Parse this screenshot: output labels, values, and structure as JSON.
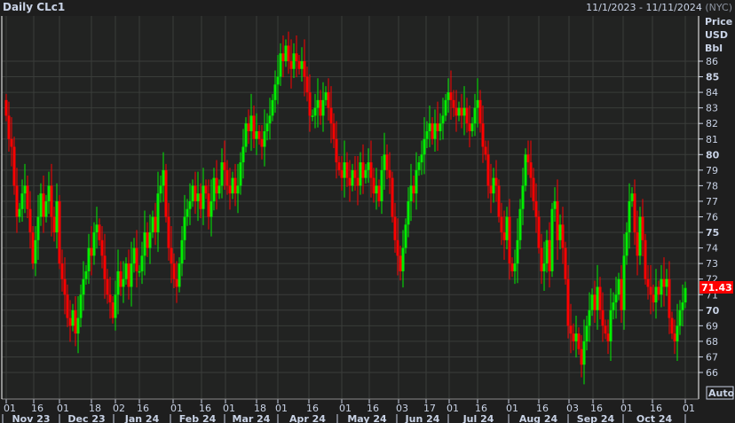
{
  "header": {
    "title": "Daily CLc1",
    "range": "11/1/2023 - 11/11/2024",
    "timezone": "(NYC)"
  },
  "axis": {
    "unit_lines": [
      "Price",
      "USD",
      "Bbl"
    ],
    "auto_label": "Auto"
  },
  "colors": {
    "up": "#00ee00",
    "down": "#ff0000",
    "background": "#222322",
    "grid": "#3a3d3a",
    "text": "#c9d3e6",
    "last_price_bg": "#ff0000"
  },
  "chart_data": {
    "type": "candlestick",
    "title": "Daily CLc1",
    "ylabel": "Price USD Bbl",
    "ylim": [
      65.2,
      88.3
    ],
    "y_ticks": [
      66,
      67,
      68,
      69,
      70,
      71,
      72,
      73,
      74,
      75,
      76,
      77,
      78,
      79,
      80,
      81,
      82,
      83,
      84,
      85,
      86
    ],
    "grid": true,
    "last_price": "71.43",
    "day_ticks": [
      "01",
      "16",
      "01",
      "18",
      "02",
      "16",
      "01",
      "16",
      "01",
      "18",
      "01",
      "16",
      "01",
      "16",
      "03",
      "17",
      "01",
      "16",
      "01",
      "16",
      "03",
      "16",
      "01",
      "16",
      "01"
    ],
    "month_labels": [
      "Nov 23",
      "Dec 23",
      "Jan 24",
      "Feb 24",
      "Mar 24",
      "Apr 24",
      "May 24",
      "Jun 24",
      "Jul 24",
      "Aug 24",
      "Sep 24",
      "Oct 24"
    ],
    "first_open": 83.5,
    "close": [
      82.5,
      81,
      80.5,
      78,
      76,
      76.5,
      77.5,
      78,
      76.5,
      75,
      73,
      74.5,
      76,
      77.5,
      76,
      77,
      78,
      76,
      75,
      77,
      73,
      72,
      71,
      69.5,
      69,
      70,
      68.5,
      69.5,
      71,
      72,
      72.5,
      74,
      73.5,
      75,
      75.5,
      74.5,
      73.5,
      72,
      71,
      70.5,
      69.5,
      71,
      72.5,
      71.5,
      72,
      73,
      71.5,
      73,
      74,
      72.5,
      72.5,
      73.5,
      75,
      74,
      75,
      76,
      75,
      77.5,
      78,
      79,
      76,
      74,
      73,
      72,
      71.5,
      73,
      74.5,
      76,
      76.5,
      77,
      78,
      77,
      77.5,
      76.5,
      78,
      77.5,
      76,
      77,
      78.5,
      77.5,
      78,
      79.5,
      79,
      78,
      77.5,
      78.5,
      77.5,
      78,
      79.5,
      80.5,
      82,
      81.5,
      82.5,
      81,
      81.5,
      81,
      80.5,
      81.5,
      82,
      82.5,
      83.5,
      84.5,
      85,
      86.5,
      86,
      87,
      86,
      85.5,
      86.5,
      86,
      85.5,
      86,
      85,
      84,
      82.5,
      82.5,
      83,
      83.5,
      82.5,
      83.5,
      84,
      83,
      82,
      81,
      79.5,
      79,
      78.5,
      79.5,
      78.5,
      78,
      79,
      78.5,
      78,
      79.5,
      78.5,
      79,
      79.5,
      78.5,
      77.5,
      78,
      77,
      79,
      80,
      79,
      78.5,
      76,
      74.5,
      73.5,
      72.5,
      74,
      75.5,
      77,
      78,
      77.5,
      79,
      79.5,
      80,
      81,
      81.5,
      82,
      81,
      82,
      81.5,
      82,
      82.5,
      83.5,
      84,
      83.5,
      83,
      82.5,
      83,
      82.5,
      83,
      82,
      81.5,
      82,
      83,
      83.5,
      82,
      80.5,
      80,
      78,
      77.5,
      78.5,
      78,
      76,
      75,
      74.5,
      76,
      73,
      72.5,
      73,
      74.5,
      76.5,
      78,
      80,
      79.5,
      78.5,
      77,
      76,
      74,
      72.5,
      73,
      74.5,
      72.5,
      76.5,
      77,
      74.5,
      75.5,
      74,
      72,
      69,
      68.5,
      68,
      68.5,
      67.5,
      66.5,
      68,
      69,
      70,
      71,
      70,
      71.5,
      70,
      69,
      68.5,
      68,
      70,
      70.5,
      71,
      72,
      70,
      73.5,
      75,
      77,
      77.5,
      75,
      73.5,
      76,
      74.5,
      72,
      71.5,
      71,
      70.5,
      71.5,
      71,
      72,
      71.5,
      72,
      69.5,
      68.5,
      68,
      69,
      70,
      70.5,
      71.43
    ]
  }
}
